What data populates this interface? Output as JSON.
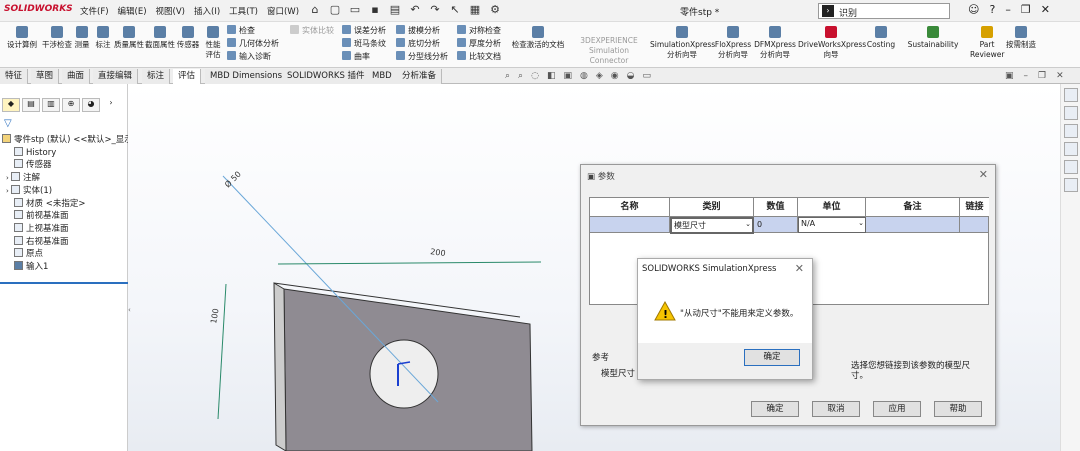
{
  "app": {
    "logo": "SOLIDWORKS",
    "doc_title": "零件stp *",
    "search_placeholder": "识别"
  },
  "menu": [
    "文件(F)",
    "编辑(E)",
    "视图(V)",
    "插入(I)",
    "工具(T)",
    "窗口(W)"
  ],
  "ribbon": {
    "big": [
      "设计算例",
      "干涉检查",
      "测量",
      "标注",
      "质量属性",
      "截面属性",
      "传感器",
      "性能评估"
    ],
    "small_a": [
      "检查",
      "几何体分析",
      "输入诊断"
    ],
    "small_b": [
      "误差分析",
      "斑马条纹",
      "曲率"
    ],
    "small_c": [
      "拔模分析",
      "底切分析",
      "分型线分析"
    ],
    "small_d": [
      "对称检查",
      "厚度分析",
      "比较文档"
    ],
    "solid_compare": "实体比较",
    "check_active": "检查激活的文档",
    "threedx": "3DEXPERIENCE Simulation Connector",
    "right": [
      "SimulationXpress 分析向导",
      "FloXpress 分析向导",
      "DFMXpress 分析向导",
      "DriveWorksXpress 向导",
      "Costing",
      "Sustainability",
      "Part Reviewer",
      "按需制造"
    ]
  },
  "tabs": [
    "特征",
    "草图",
    "曲面",
    "直接编辑",
    "标注",
    "评估",
    "MBD Dimensions",
    "SOLIDWORKS 插件",
    "MBD",
    "分析准备"
  ],
  "tree": {
    "root": "零件stp (默认) <<默认>_显示",
    "items": [
      "History",
      "传感器",
      "注解",
      "实体(1)",
      "材质 <未指定>",
      "前视基准面",
      "上视基准面",
      "右视基准面",
      "原点",
      "输入1"
    ]
  },
  "model": {
    "dim_diameter": "Ø 50",
    "dim_width": "200",
    "dim_height": "100"
  },
  "params_dialog": {
    "title": "参数",
    "headers": [
      "名称",
      "类别",
      "数值",
      "单位",
      "备注",
      "链接"
    ],
    "row": {
      "category": "模型尺寸",
      "value": "0",
      "unit": "N/A"
    },
    "ref_label": "参考",
    "ref_field_label": "模型尺寸",
    "hint": "选择您想链接到该参数的模型尺寸。",
    "buttons": [
      "确定",
      "取消",
      "应用",
      "帮助"
    ]
  },
  "message_box": {
    "title": "SOLIDWORKS SimulationXpress",
    "text": "\"从动尺寸\"不能用来定义参数。",
    "ok": "确定"
  },
  "colors": {
    "accent": "#2a6fbf",
    "selection_row": "#c8d3ee",
    "plate": "#8f8b92",
    "warning": "#f5c400"
  }
}
